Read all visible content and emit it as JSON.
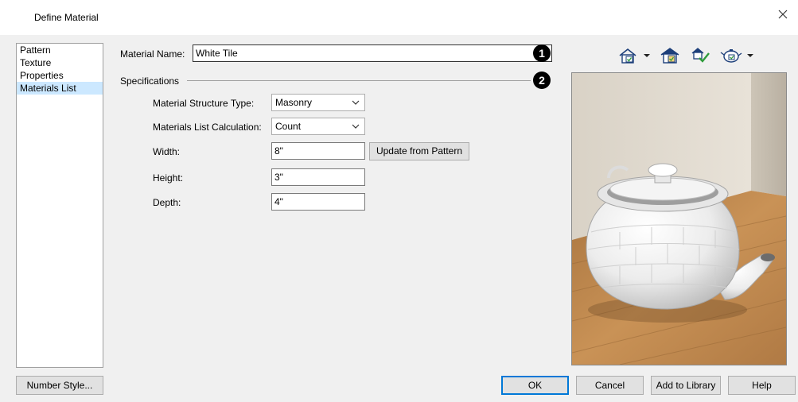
{
  "window": {
    "title": "Define Material",
    "close_icon": "close-icon"
  },
  "categories": [
    {
      "label": "Pattern"
    },
    {
      "label": "Texture"
    },
    {
      "label": "Properties"
    },
    {
      "label": "Materials List",
      "selected": true
    }
  ],
  "material_name": {
    "label": "Material Name:",
    "value": "White Tile"
  },
  "callouts": [
    "1",
    "2"
  ],
  "specifications": {
    "heading": "Specifications",
    "structure_type": {
      "label": "Material Structure Type:",
      "value": "Masonry"
    },
    "calculation": {
      "label": "Materials List Calculation:",
      "value": "Count"
    },
    "width": {
      "label": "Width:",
      "value": "8\""
    },
    "height": {
      "label": "Height:",
      "value": "3\""
    },
    "depth": {
      "label": "Depth:",
      "value": "4\""
    },
    "update_button": "Update from Pattern"
  },
  "toolbar": {
    "icons": [
      "house-view-icon",
      "house-layer-icon",
      "material-check-icon",
      "teapot-object-icon"
    ]
  },
  "buttons": {
    "number_style": "Number Style...",
    "ok": "OK",
    "cancel": "Cancel",
    "add_to_library": "Add to Library",
    "help": "Help"
  },
  "colors": {
    "selection": "#cce8ff",
    "accent": "#0078d7",
    "check_green": "#2e9b3b",
    "house_blue": "#2a66b8"
  }
}
